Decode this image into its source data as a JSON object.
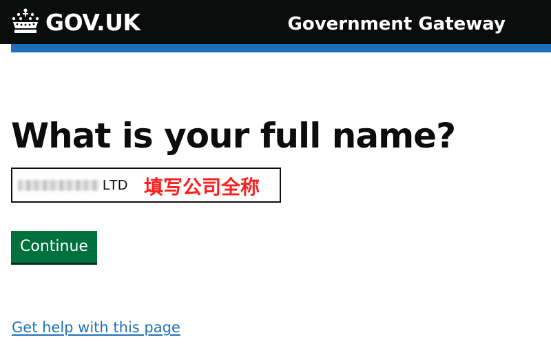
{
  "header": {
    "logo_text": "GOV.UK",
    "service_name": "Government Gateway",
    "logo_icon": "crown-icon"
  },
  "colors": {
    "header_bg": "#0b0c0c",
    "accent_bar": "#1d70b8",
    "button_green": "#00703c",
    "link_blue": "#1d70b8",
    "annotation_red": "#ff1e1e"
  },
  "main": {
    "heading": "What is your full name?",
    "name_field": {
      "visible_value": "LTD",
      "redacted": true
    },
    "annotation": "填写公司全称",
    "continue_label": "Continue",
    "help_link": "Get help with this page"
  }
}
